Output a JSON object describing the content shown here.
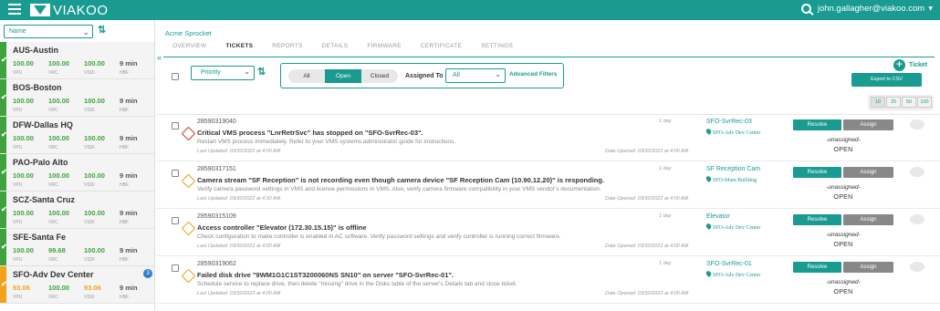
{
  "header": {
    "brand": "VIAKOO",
    "user": "john.gallagher@viakoo.com",
    "user_caret": "▾"
  },
  "sidebar": {
    "sort_select": "Name",
    "sort_icon": "⇅",
    "metric_labels": [
      "VPU",
      "VRC",
      "VSDI",
      "HBF"
    ],
    "sites": [
      {
        "name": "AUS-Austin",
        "status": "ok",
        "values": [
          "100.00",
          "100.00",
          "100.00",
          "9 min"
        ]
      },
      {
        "name": "BOS-Boston",
        "status": "ok",
        "values": [
          "100.00",
          "100.00",
          "100.00",
          "9 min"
        ]
      },
      {
        "name": "DFW-Dallas HQ",
        "status": "ok",
        "values": [
          "100.00",
          "100.00",
          "100.00",
          "9 min"
        ]
      },
      {
        "name": "PAO-Palo Alto",
        "status": "ok",
        "values": [
          "100.00",
          "100.00",
          "100.00",
          "9 min"
        ]
      },
      {
        "name": "SCZ-Santa Cruz",
        "status": "ok",
        "values": [
          "100.00",
          "100.00",
          "100.00",
          "9 min"
        ]
      },
      {
        "name": "SFE-Santa Fe",
        "status": "ok",
        "values": [
          "100.00",
          "99.68",
          "100.00",
          "9 min"
        ]
      },
      {
        "name": "SFO-Adv Dev Center",
        "status": "warn",
        "badge": "3",
        "values": [
          "93.06",
          "100.00",
          "93.06",
          "9 min"
        ]
      }
    ]
  },
  "main": {
    "collapse_icon": "«",
    "site_title": "Acme Sprocket",
    "tabs": [
      "OVERVIEW",
      "TICKETS",
      "REPORTS",
      "DETAILS",
      "FIRMWARE",
      "CERTIFICATE",
      "SETTINGS"
    ],
    "active_tab": "TICKETS",
    "filters": {
      "priority": "Priority",
      "sort_icon": "⇅",
      "segments": [
        "All",
        "Open",
        "Closed"
      ],
      "active_segment": "Open",
      "assigned_label": "Assigned To",
      "assigned_value": "All",
      "advanced": "Advanced Filters"
    },
    "new_ticket": "Ticket",
    "export": "Export to CSV",
    "page_sizes": [
      "10",
      "25",
      "50",
      "100"
    ],
    "page_size_selected": "10"
  },
  "tickets": [
    {
      "id": "28590319040",
      "severity": "critical",
      "title": "Critical VMS process \"LnrRetrSvc\" has stopped on \"SFO-SvrRec-03\".",
      "description": "Restart VMS process immediately. Refer to your VMS systems administrator guide for instructions.",
      "updated": "Last Updated: 03/30/2022 at 4:00 AM",
      "opened": "Date Opened: 03/30/2022 at 4:00 AM",
      "age": "1 day",
      "device": "SFO-SvrRec-03",
      "location": "SFO-Adv Dev Center",
      "resolve": "Resolve",
      "assign": "Assign",
      "assignee": "-unassigned-",
      "status": "OPEN"
    },
    {
      "id": "28590317151",
      "severity": "warning",
      "title": "Camera stream \"SF Reception\" is not recording even though camera device \"SF Reception Cam (10.90.12.20)\" is responding.",
      "description": "Verify camera password settings in VMS and license permissions in VMS. Also, verify camera firmware compatibility in your VMS vendor's documentation.",
      "updated": "Last Updated: 03/30/2022 at 4:30 AM",
      "opened": "Date Opened: 03/30/2022 at 4:00 AM",
      "age": "1 day",
      "device": "SF Reception Cam",
      "location": "SFO-Main Building",
      "resolve": "Resolve",
      "assign": "Assign",
      "assignee": "-unassigned-",
      "status": "OPEN"
    },
    {
      "id": "28590315109",
      "severity": "warning",
      "title": "Access controller \"Elevator (172.30.15.15)\" is offline",
      "description": "Check configuration to make controller is enabled in AC software. Verify password settings and verify controller is running correct firmware.",
      "updated": "Last Updated: 03/30/2022 at 4:00 AM",
      "opened": "Date Opened: 03/30/2022 at 4:00 AM",
      "age": "1 day",
      "device": "Elevator",
      "location": "SFO-Adv Dev Center",
      "resolve": "Resolve",
      "assign": "Assign",
      "assignee": "-unassigned-",
      "status": "OPEN"
    },
    {
      "id": "28590319062",
      "severity": "warning",
      "title": "Failed disk drive \"9WM1G1C1ST3200060NS SN10\" on server \"SFO-SvrRec-01\".",
      "description": "Schedule service to replace drive, then delete \"missing\" drive in the Disks table of the server's Details tab and close ticket.",
      "updated": "Last Updated: 03/30/2022 at 4:00 AM",
      "opened": "Date Opened: 03/30/2022 at 4:00 AM",
      "age": "1 day",
      "device": "SFO-SvrRec-01",
      "location": "SFO-Adv Dev Center",
      "resolve": "Resolve",
      "assign": "Assign",
      "assignee": "-unassigned-",
      "status": "OPEN"
    }
  ],
  "colors": {
    "brand": "#1a9b92",
    "ok": "#3ea33e",
    "warn": "#f3a21b",
    "critical": "#d13b2d",
    "badge": "#2d7fd1"
  }
}
